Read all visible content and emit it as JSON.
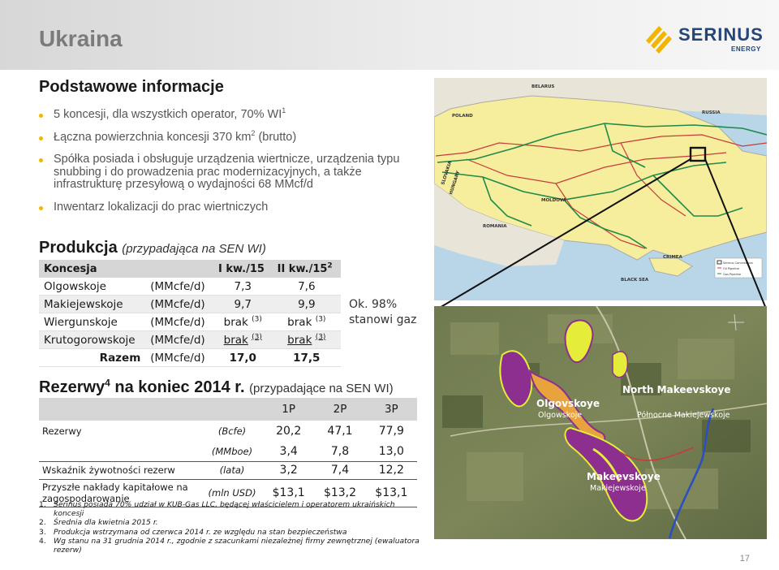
{
  "slide": {
    "title": "Ukraina",
    "page_number": "17"
  },
  "logo": {
    "name": "SERINUS",
    "sub": "ENERGY",
    "colors": {
      "navy": "#24457a",
      "gold": "#f2b600"
    }
  },
  "basic_info": {
    "heading": "Podstawowe informacje",
    "bullets": [
      {
        "text": "5 koncesji, dla wszystkich operator, 70% WI",
        "sup": "1"
      },
      {
        "text": "Łączna powierzchnia koncesji 370 km",
        "sup": "2",
        "after": " (brutto)"
      },
      {
        "text": "Spółka posiada i obsługuje urządzenia wiertnicze, urządzenia typu snubbing i do prowadzenia prac modernizacyjnych, a także infrastrukturę przesyłową o wydajności 68 MMcf/d"
      },
      {
        "text": "Inwentarz lokalizacji do prac wiertniczych"
      }
    ]
  },
  "production": {
    "heading": "Produkcja",
    "subheading": "(przypadająca na SEN WI)",
    "columns": {
      "name": "Koncesja",
      "q1": "I kw./15",
      "q2": "II kw./15",
      "q2_sup": "2"
    },
    "rows": [
      {
        "name": "Olgowskoje",
        "unit": "(MMcfe/d)",
        "q1": "7,3",
        "q2": "7,6"
      },
      {
        "name": "Makiejewskoje",
        "unit": "(MMcfe/d)",
        "q1": "9,7",
        "q2": "9,9"
      },
      {
        "name": "Wiergunskoje",
        "unit": "(MMcfe/d)",
        "q1": "brak",
        "q1_sup": "(3)",
        "q2": "brak",
        "q2_sup": "(3)"
      },
      {
        "name": "Krutogorowskoje",
        "unit": "(MMcfe/d)",
        "q1": "brak",
        "q1_sup": "(3)",
        "q2": "brak",
        "q2_sup": "(3)"
      },
      {
        "name": "Razem",
        "unit": "(MMcfe/d)",
        "q1": "17,0",
        "q2": "17,5"
      }
    ],
    "note_line1": "Ok. 98%",
    "note_line2": "stanowi gaz"
  },
  "reserves": {
    "heading_pre": "Rezerwy",
    "heading_sup": "4",
    "heading_post": " na koniec 2014 r.",
    "subheading": "(przypadające na SEN WI)",
    "columns": [
      "1P",
      "2P",
      "3P"
    ],
    "rows": [
      {
        "label": "Rezerwy",
        "unit": "(Bcfe)",
        "values": [
          "20,2",
          "47,1",
          "77,9"
        ]
      },
      {
        "label": "",
        "unit": "(MMboe)",
        "values": [
          "3,4",
          "7,8",
          "13,0"
        ]
      },
      {
        "label": "Wskaźnik żywotności rezerw",
        "unit": "(lata)",
        "values": [
          "3,2",
          "7,4",
          "12,2"
        ]
      },
      {
        "label": "Przyszłe nakłady kapitałowe na zagospodarowanie",
        "unit": "(mln USD)",
        "values": [
          "$13,1",
          "$13,2",
          "$13,1"
        ]
      }
    ]
  },
  "footnotes": [
    {
      "num": "1.",
      "text": "Serinus posiada 70% udział w KUB-Gas LLC, będącej właścicielem i operatorem ukraińskich koncesji"
    },
    {
      "num": "2.",
      "text": "Średnia dla kwietnia 2015 r."
    },
    {
      "num": "3.",
      "text": "Produkcja wstrzymana od czerwca 2014 r. ze względu na stan bezpieczeństwa"
    },
    {
      "num": "4.",
      "text": "Wg stanu na 31 grudnia 2014 r., zgodnie z szacunkami niezależnej firmy zewnętrznej (ewaluatora rezerw)"
    }
  ],
  "map": {
    "labels": {
      "belarus": "BELARUS",
      "poland": "POLAND",
      "russia": "RUSSIA",
      "slovakia": "SLOVAKIA",
      "hungary": "HUNGARY",
      "moldova": "MOLDOVA",
      "romania": "ROMANIA",
      "crimea": "CRIMEA",
      "black_sea": "BLACK SEA"
    },
    "legend": [
      "Serinus Concessions",
      "Oil Pipeline",
      "Gas Pipeline"
    ]
  },
  "satellite": {
    "fields": [
      {
        "title": "Olgovskoye",
        "subtitle": "Olgowskoje"
      },
      {
        "title": "North Makeevskoye",
        "subtitle": "Północne Makiejewskoje"
      },
      {
        "title": "Makeevskoye",
        "subtitle": "Makiejewskoje"
      }
    ]
  }
}
